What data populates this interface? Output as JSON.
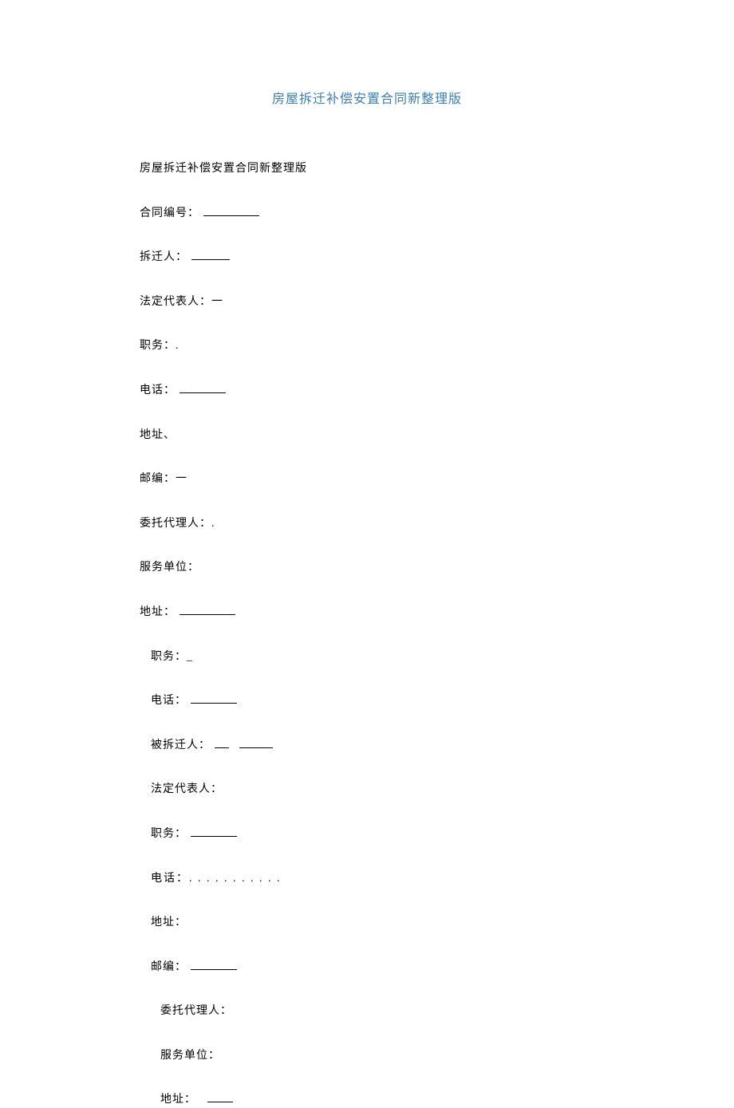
{
  "title": "房屋拆迁补偿安置合同新整理版",
  "heading": "房屋拆迁补偿安置合同新整理版",
  "fields": {
    "contract_no": "合同编号：",
    "relocator": "拆迁人：",
    "legal_rep": "法定代表人：一",
    "position": "职务：.",
    "phone": "电话：",
    "address_comma": "地址、",
    "postcode": "邮编：一",
    "agent": "委托代理人：.",
    "service_unit": "服务单位：",
    "address_colon": "地址：",
    "position2": "职务：_",
    "phone2": "电话：",
    "relocatee": "被拆迁人：",
    "legal_rep2": "法定代表人：",
    "position3": "职务：",
    "phone3": "电话：. . . . . . . . . . .",
    "address3": "地址：",
    "postcode2": "邮编：",
    "agent2": "委托代理人：",
    "service_unit2": "服务单位：",
    "address4": "地址："
  }
}
